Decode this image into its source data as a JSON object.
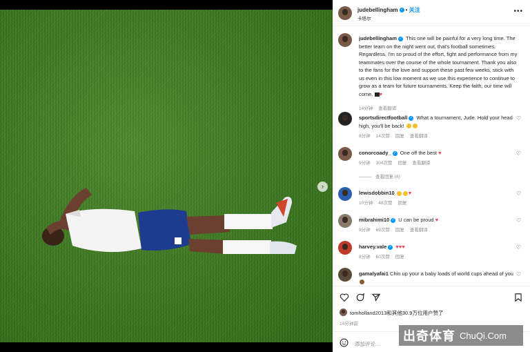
{
  "header": {
    "username": "judebellingham",
    "follow_label": "关注",
    "follow_sep": "•",
    "location": "卡塔尔"
  },
  "caption": {
    "username": "judebellingham",
    "text": "This one will be painful for a very long time. The better team on the night went out, that's football sometimes. Regardless, I'm so proud of the effort, fight and performance from my teammates over the course of the whole tournament. Thank you also to the fans for the love and support these past few weeks, stick with us even in this low moment as we use this experience to continue to grow as a team for future tournaments. Keep the faith, our time will come.",
    "time": "14分钟",
    "translate": "查看翻译"
  },
  "comments": [
    {
      "username": "sportsdirectfootball",
      "text": "What a tournament, Jude. Hold your head high, you'll be back!",
      "time": "8分钟",
      "likes": "14次赞",
      "reply": "回复",
      "translate": "查看翻译",
      "verified": true
    },
    {
      "username": "conorcoady_",
      "text": "One off the best",
      "time": "9分钟",
      "likes": "304次赞",
      "reply": "回复",
      "translate": "查看翻译",
      "verified": true,
      "replies": "查看回复 (6)"
    },
    {
      "username": "lewisdobbin10",
      "text": "",
      "time": "10分钟",
      "likes": "48次赞",
      "reply": "回复",
      "verified": false
    },
    {
      "username": "mibrahimi10",
      "text": "U can be proud",
      "time": "9分钟",
      "likes": "69次赞",
      "reply": "回复",
      "translate": "查看翻译",
      "verified": true
    },
    {
      "username": "harvey.vale",
      "text": "",
      "time": "8分钟",
      "likes": "60次赞",
      "reply": "回复",
      "verified": true
    },
    {
      "username": "gamalyafai1",
      "text": "Chin up your a baby loads of world cups ahead of you",
      "verified": false
    }
  ],
  "liked_by": "tomholland2013和其他30.9万位用户赞了",
  "post_time": "14分钟前",
  "add_comment_placeholder": "添加评论...",
  "watermark": {
    "cn": "出奇体育",
    "en": "ChuQi.Com"
  },
  "colors": {
    "accent": "#0095f6",
    "heart": "#ed4956",
    "muted": "#8e8e8e"
  }
}
